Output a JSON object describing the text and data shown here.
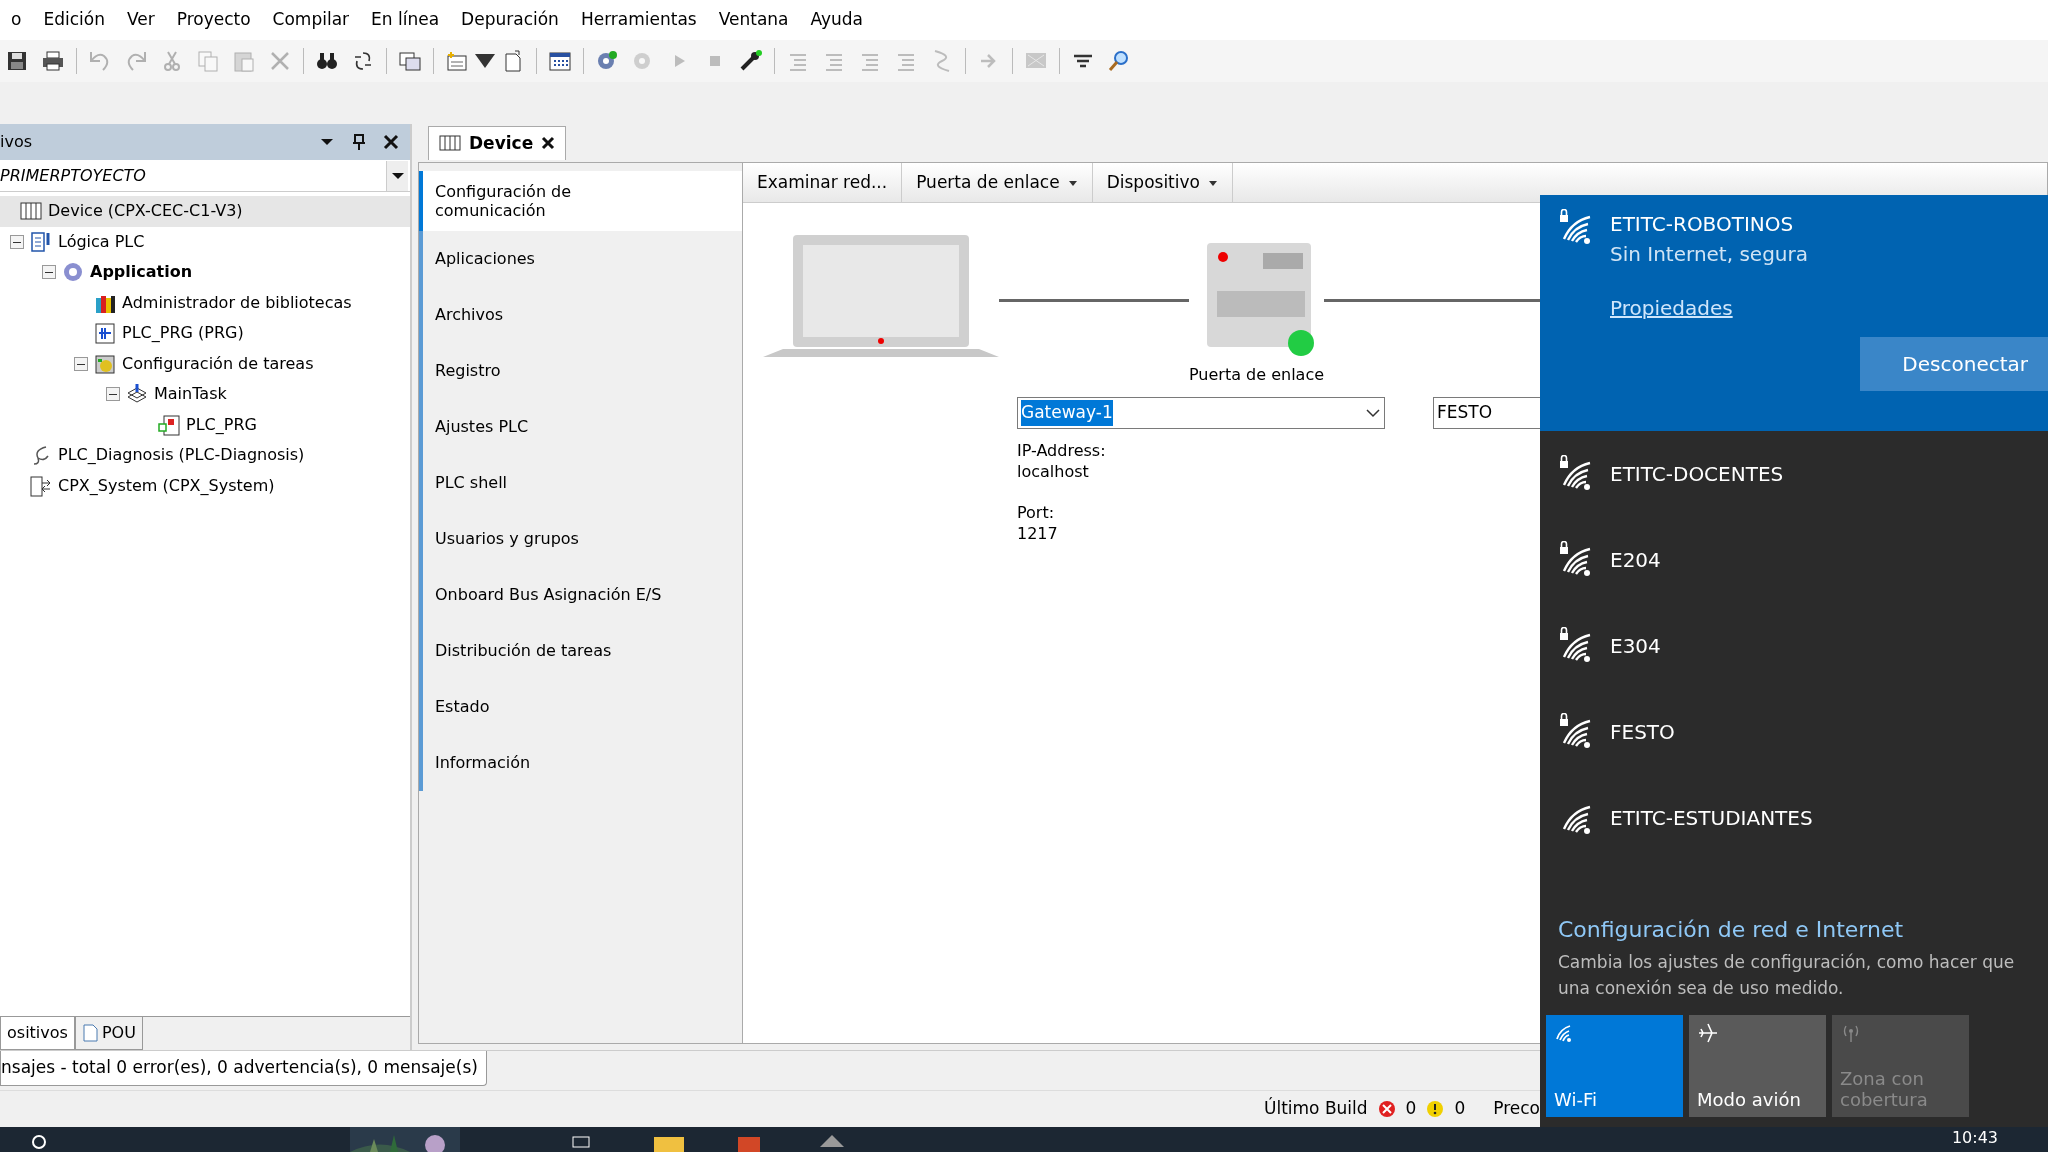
{
  "menu": [
    {
      "label": "o"
    },
    {
      "label": "Edición"
    },
    {
      "label": "Ver"
    },
    {
      "label": "Proyecto"
    },
    {
      "label": "Compilar"
    },
    {
      "label": "En línea"
    },
    {
      "label": "Depuración"
    },
    {
      "label": "Herramientas"
    },
    {
      "label": "Ventana"
    },
    {
      "label": "Ayuda"
    }
  ],
  "toolbar": [
    {
      "kind": "save",
      "disabled": false
    },
    {
      "kind": "print",
      "disabled": false
    },
    {
      "kind": "sep"
    },
    {
      "kind": "undo",
      "disabled": true
    },
    {
      "kind": "redo",
      "disabled": true
    },
    {
      "kind": "cut",
      "disabled": true
    },
    {
      "kind": "copy",
      "disabled": true
    },
    {
      "kind": "paste",
      "disabled": true
    },
    {
      "kind": "delete",
      "disabled": true
    },
    {
      "kind": "sep"
    },
    {
      "kind": "find",
      "disabled": false
    },
    {
      "kind": "replace",
      "disabled": false
    },
    {
      "kind": "sep"
    },
    {
      "kind": "pages",
      "disabled": false
    },
    {
      "kind": "sep"
    },
    {
      "kind": "add",
      "disabled": false
    },
    {
      "kind": "caret",
      "disabled": false
    },
    {
      "kind": "open",
      "disabled": false
    },
    {
      "kind": "sep"
    },
    {
      "kind": "grid",
      "disabled": false
    },
    {
      "kind": "sep"
    },
    {
      "kind": "login",
      "disabled": false
    },
    {
      "kind": "logout",
      "disabled": true
    },
    {
      "kind": "start",
      "disabled": true
    },
    {
      "kind": "stop",
      "disabled": true
    },
    {
      "kind": "tools",
      "disabled": false
    },
    {
      "kind": "sep"
    },
    {
      "kind": "lines",
      "disabled": true
    },
    {
      "kind": "lines",
      "disabled": true
    },
    {
      "kind": "lines",
      "disabled": true
    },
    {
      "kind": "lines",
      "disabled": true
    },
    {
      "kind": "step",
      "disabled": true
    },
    {
      "kind": "sep"
    },
    {
      "kind": "arrow",
      "disabled": true
    },
    {
      "kind": "sep"
    },
    {
      "kind": "monitor",
      "disabled": true
    },
    {
      "kind": "sep"
    },
    {
      "kind": "filter",
      "disabled": false
    },
    {
      "kind": "zoom",
      "disabled": false
    }
  ],
  "devices_panel": {
    "title": "ivos",
    "project": "PRIMERPTOYECTO",
    "tree": [
      {
        "label": "Device (CPX-CEC-C1-V3)",
        "kind": "device",
        "selected": true,
        "bold": false,
        "children": [
          {
            "label": "Lógica PLC",
            "kind": "logic",
            "selected": false,
            "bold": false,
            "expanded": true,
            "children": [
              {
                "label": "Application",
                "kind": "application",
                "selected": false,
                "bold": true,
                "expanded": true,
                "children": [
                  {
                    "label": "Administrador de bibliotecas",
                    "kind": "library",
                    "selected": false,
                    "bold": false
                  },
                  {
                    "label": "PLC_PRG (PRG)",
                    "kind": "program",
                    "selected": false,
                    "bold": false
                  },
                  {
                    "label": "Configuración de tareas",
                    "kind": "taskconfig",
                    "selected": false,
                    "bold": false,
                    "expanded": true,
                    "children": [
                      {
                        "label": "MainTask",
                        "kind": "task",
                        "selected": false,
                        "bold": false,
                        "expanded": true,
                        "children": [
                          {
                            "label": "PLC_PRG",
                            "kind": "call",
                            "selected": false,
                            "bold": false
                          }
                        ]
                      }
                    ]
                  }
                ]
              }
            ]
          },
          {
            "label": "PLC_Diagnosis (PLC-Diagnosis)",
            "kind": "diagnosis",
            "selected": false,
            "bold": false
          },
          {
            "label": "CPX_System (CPX_System)",
            "kind": "system",
            "selected": false,
            "bold": false
          }
        ]
      }
    ],
    "tabs": [
      {
        "label": "ositivos",
        "selected": true
      },
      {
        "label": "POU",
        "selected": false
      }
    ]
  },
  "editor": {
    "tab": "Device",
    "nav": [
      {
        "label": "Configuración de comunicación",
        "selected": true
      },
      {
        "label": "Aplicaciones",
        "selected": false
      },
      {
        "label": "Archivos",
        "selected": false
      },
      {
        "label": "Registro",
        "selected": false
      },
      {
        "label": "Ajustes PLC",
        "selected": false
      },
      {
        "label": "PLC shell",
        "selected": false
      },
      {
        "label": "Usuarios y grupos",
        "selected": false
      },
      {
        "label": "Onboard Bus Asignación E/S",
        "selected": false
      },
      {
        "label": "Distribución de tareas",
        "selected": false
      },
      {
        "label": "Estado",
        "selected": false
      },
      {
        "label": "Información",
        "selected": false
      }
    ],
    "toolbar": [
      {
        "label": "Examinar red...",
        "dropdown": false
      },
      {
        "label": "Puerta de enlace",
        "dropdown": true
      },
      {
        "label": "Dispositivo",
        "dropdown": true
      }
    ],
    "gateway": {
      "caption": "Puerta de enlace",
      "online": true,
      "selection": "Gateway-1",
      "ip_label": "IP-Address:",
      "ip": "localhost",
      "port_label": "Port:",
      "port": "1217"
    },
    "device_field": "FESTO"
  },
  "messages": "nsajes - total 0 error(es), 0 advertencia(s), 0 mensaje(s)",
  "status_bar": {
    "build_label": "Último Build",
    "errors": "0",
    "warnings": "0",
    "precompile": "Preco"
  },
  "wifi_flyout": {
    "networks": [
      {
        "name": "ETITC-ROBOTINOS",
        "secured": true,
        "connected": true,
        "status": "Sin Internet, segura",
        "link": "Propiedades",
        "button": "Desconectar"
      },
      {
        "name": "ETITC-DOCENTES",
        "secured": true,
        "connected": false
      },
      {
        "name": "E204",
        "secured": true,
        "connected": false
      },
      {
        "name": "E304",
        "secured": true,
        "connected": false
      },
      {
        "name": "FESTO",
        "secured": true,
        "connected": false
      },
      {
        "name": "ETITC-ESTUDIANTES",
        "secured": false,
        "connected": false
      }
    ],
    "settings_link": "Configuración de red e Internet",
    "settings_text": "Cambia los ajustes de configuración, como hacer que una conexión sea de uso medido.",
    "tiles": [
      {
        "label": "Wi-Fi",
        "kind": "wifi",
        "on": true,
        "disabled": false
      },
      {
        "label": "Modo avión",
        "kind": "plane",
        "on": false,
        "disabled": false
      },
      {
        "label": "Zona con cobertura",
        "kind": "hotspot",
        "on": false,
        "disabled": true
      }
    ]
  },
  "taskbar": {
    "time": "10:43"
  }
}
